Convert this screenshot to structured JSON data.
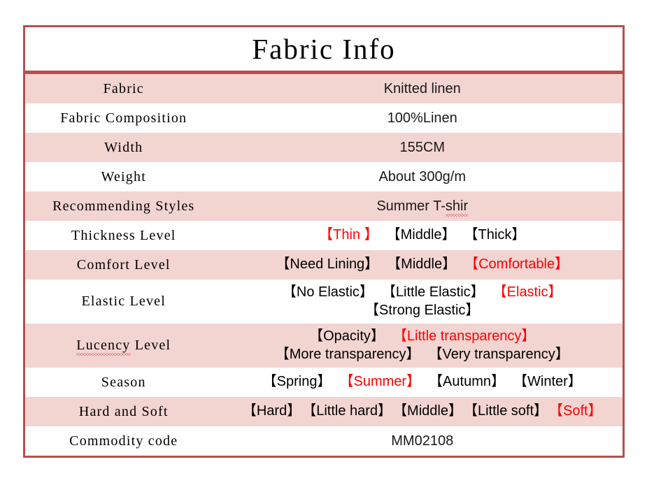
{
  "document": {
    "title": "Fabric Info"
  },
  "colors": {
    "border": "#b3504e",
    "row_fill": "#f2d4d1",
    "selected": "#ff0000",
    "text": "#000000"
  },
  "rows": [
    {
      "label": "Fabric",
      "type": "text",
      "value": "Knitted linen"
    },
    {
      "label": "Fabric Composition",
      "type": "text",
      "value": "100%Linen"
    },
    {
      "label": "Width",
      "type": "text",
      "value": "155CM"
    },
    {
      "label": "Weight",
      "type": "text",
      "value": "About 300g/m"
    },
    {
      "label": "Recommending Styles",
      "type": "text",
      "value": "Summer T-shir",
      "value_misspelled_part": "shir",
      "value_prefix": "Summer T-"
    },
    {
      "label": "Thickness Level",
      "type": "options",
      "lines": [
        [
          {
            "text": "【Thin 】",
            "selected": true
          },
          {
            "text": "【Middle】",
            "selected": false
          },
          {
            "text": "【Thick】",
            "selected": false
          }
        ]
      ]
    },
    {
      "label": "Comfort Level",
      "type": "options",
      "lines": [
        [
          {
            "text": "【Need Lining】",
            "selected": false
          },
          {
            "text": "【Middle】",
            "selected": false
          },
          {
            "text": "【Comfortable】",
            "selected": true
          }
        ]
      ]
    },
    {
      "label": "Elastic Level",
      "type": "options",
      "lines": [
        [
          {
            "text": "【No Elastic】",
            "selected": false
          },
          {
            "text": "【Little Elastic】",
            "selected": false
          },
          {
            "text": "【Elastic】",
            "selected": true
          }
        ],
        [
          {
            "text": "【Strong Elastic】",
            "selected": false
          }
        ]
      ]
    },
    {
      "label": "Lucency Level",
      "label_misspelled_part": "Lucency",
      "label_suffix": " Level",
      "type": "options",
      "lines": [
        [
          {
            "text": "【Opacity】",
            "selected": false
          },
          {
            "text": "【Little transparency】",
            "selected": true
          }
        ],
        [
          {
            "text": "【More transparency】",
            "selected": false
          },
          {
            "text": "【Very transparency】",
            "selected": false
          }
        ]
      ]
    },
    {
      "label": "Season",
      "type": "options",
      "lines": [
        [
          {
            "text": "【Spring】",
            "selected": false
          },
          {
            "text": "【Summer】",
            "selected": true
          },
          {
            "text": "【Autumn】",
            "selected": false
          },
          {
            "text": "【Winter】",
            "selected": false
          }
        ]
      ]
    },
    {
      "label": "Hard and Soft",
      "type": "options",
      "tight": true,
      "lines": [
        [
          {
            "text": "【Hard】",
            "selected": false
          },
          {
            "text": "【Little hard】",
            "selected": false
          },
          {
            "text": "【Middle】",
            "selected": false
          },
          {
            "text": "【Little soft】",
            "selected": false
          },
          {
            "text": "【Soft】",
            "selected": true
          }
        ]
      ]
    },
    {
      "label": "Commodity code",
      "type": "text",
      "value": "MM02108"
    }
  ]
}
